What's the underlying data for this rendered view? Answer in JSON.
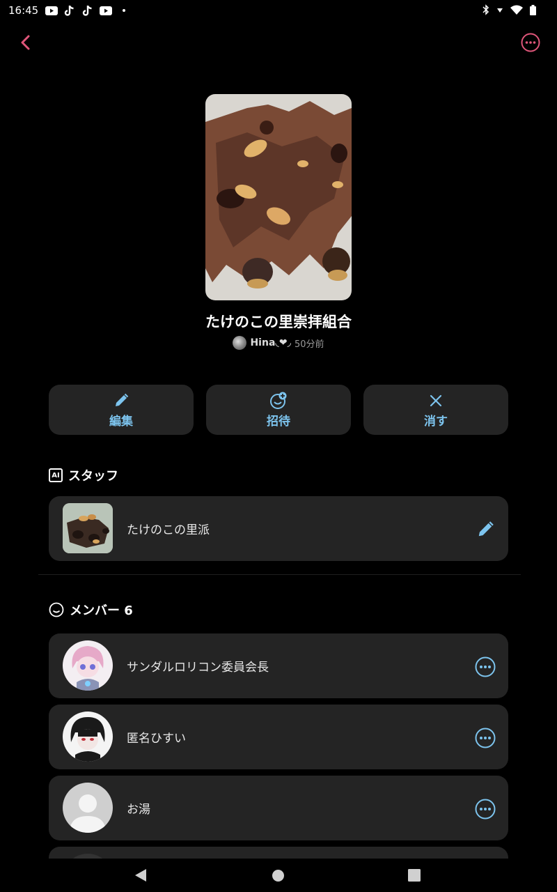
{
  "status_bar": {
    "time": "16:45",
    "app_icons": [
      "youtube-icon",
      "tiktok-icon",
      "tiktok-icon",
      "youtube-icon",
      "dot-icon"
    ],
    "system_icons": [
      "bluetooth-icon",
      "signal-icon",
      "wifi-icon",
      "battery-icon"
    ]
  },
  "colors": {
    "accent_pink": "#e0567a",
    "accent_blue": "#7dc4ee",
    "card_bg": "#242424"
  },
  "group": {
    "title": "たけのこの里崇拝組合",
    "owner_name": "Hina◟❤︎◞",
    "posted_time": "50分前"
  },
  "actions": [
    {
      "label": "編集",
      "icon": "pencil-icon"
    },
    {
      "label": "招待",
      "icon": "invite-icon"
    },
    {
      "label": "消す",
      "icon": "close-icon"
    }
  ],
  "staff_section": {
    "title": "スタッフ",
    "badge": "AI",
    "items": [
      {
        "name": "たけのこの里派"
      }
    ]
  },
  "members_section": {
    "title": "メンバー 6",
    "items": [
      {
        "name": "サンダルロリコン委員会長"
      },
      {
        "name": "匿名ひすい"
      },
      {
        "name": "お湯"
      }
    ]
  }
}
